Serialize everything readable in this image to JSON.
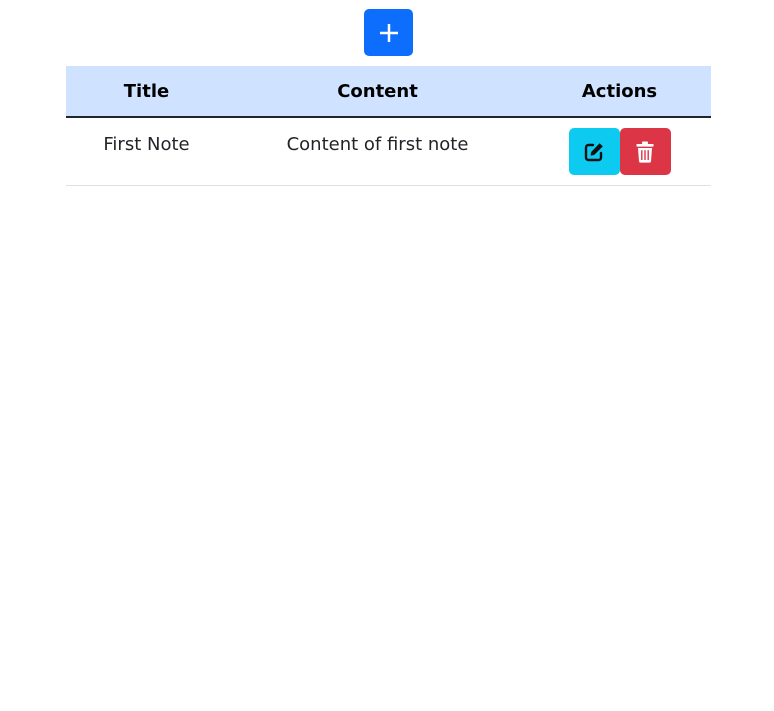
{
  "toolbar": {
    "add_label": "+"
  },
  "table": {
    "headers": [
      "Title",
      "Content",
      "Actions"
    ],
    "rows": [
      {
        "title": "First Note",
        "content": "Content of first note",
        "actions": {
          "edit_icon": "edit-icon",
          "delete_icon": "trash-icon"
        }
      }
    ]
  },
  "colors": {
    "add_button": "#0d6efd",
    "header_background": "#cfe2ff",
    "edit_button": "#0dcaf0",
    "delete_button": "#dc3545",
    "header_border": "#212529",
    "row_border": "#dee2e6"
  }
}
